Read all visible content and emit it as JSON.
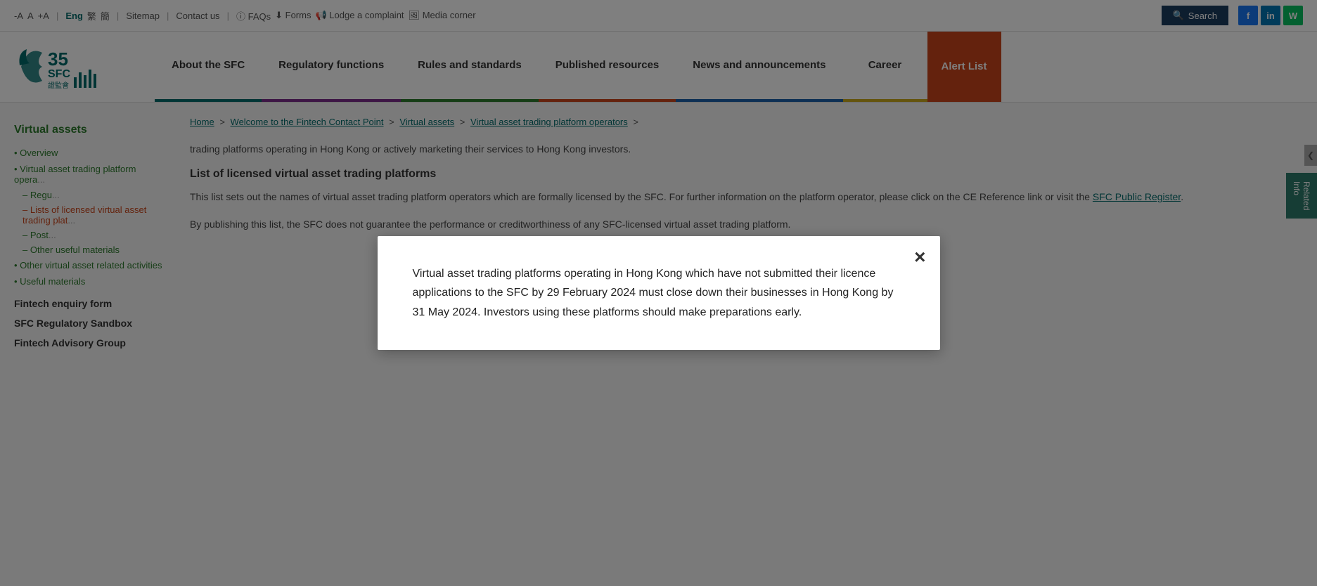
{
  "topbar": {
    "font_decrease": "-A",
    "font_normal": "A",
    "font_increase": "+A",
    "lang_eng": "Eng",
    "lang_trad": "繁",
    "lang_simp": "簡",
    "sitemap": "Sitemap",
    "contact": "Contact us",
    "faqs": "FAQs",
    "forms": "Forms",
    "complaint": "Lodge a complaint",
    "media": "Media corner",
    "search_label": "Search",
    "social": {
      "fb": "f",
      "li": "in",
      "wc": "W"
    }
  },
  "nav": {
    "about": "About the SFC",
    "regulatory": "Regulatory functions",
    "rules": "Rules and standards",
    "published": "Published resources",
    "news": "News and announcements",
    "career": "Career",
    "alert": "Alert List"
  },
  "logo": {
    "alt": "SFC 35 Logo"
  },
  "breadcrumb": {
    "home": "Home",
    "fintech": "Welcome to the Fintech Contact Point",
    "virtual": "Virtual assets",
    "operators": "Virtual asset trading platform operators"
  },
  "sidebar": {
    "title": "Virtual assets",
    "items": [
      {
        "label": "Overview",
        "type": "item"
      },
      {
        "label": "Virtual asset trading platform operators",
        "type": "item"
      },
      {
        "label": "Regulatory framework",
        "type": "sub"
      },
      {
        "label": "Lists of licensed virtual asset trading platforms",
        "type": "sub"
      },
      {
        "label": "Post-licensing",
        "type": "sub"
      },
      {
        "label": "Other useful materials",
        "type": "sub"
      },
      {
        "label": "Other virtual asset related activities",
        "type": "item"
      },
      {
        "label": "Useful materials",
        "type": "item"
      }
    ],
    "sections": [
      {
        "label": "Fintech enquiry form"
      },
      {
        "label": "SFC Regulatory Sandbox"
      },
      {
        "label": "Fintech Advisory Group"
      }
    ]
  },
  "content": {
    "partial_text": "trading platforms operating in Hong Kong or actively marketing their services to Hong Kong investors.",
    "list_heading": "List of licensed virtual asset trading platforms",
    "para1": "This list sets out the names of virtual asset trading platform operators which are formally licensed by the SFC. For further information on the platform operator, please click on the CE Reference link or visit the",
    "sfc_register_link": "SFC Public Register",
    "para2": "By publishing this list, the SFC does not guarantee the performance or creditworthiness of any SFC-licensed virtual asset trading platform."
  },
  "modal": {
    "text": "Virtual asset trading platforms operating in Hong Kong which have not submitted their licence applications to the SFC by 29 February 2024 must close down their businesses in Hong Kong by 31 May 2024. Investors using these platforms should make preparations early.",
    "close_label": "×"
  },
  "related_info": {
    "label": "Related Info",
    "chevron": "❮"
  }
}
